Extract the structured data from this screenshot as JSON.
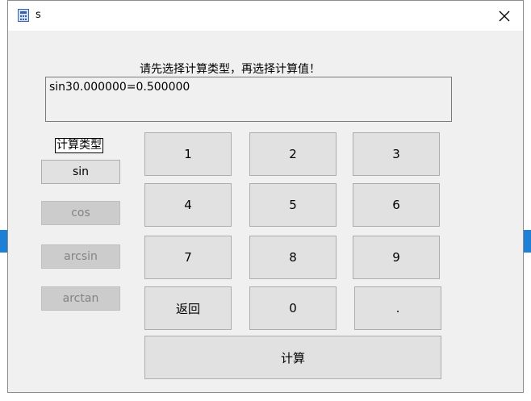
{
  "window": {
    "title": "s"
  },
  "prompt": "请先选择计算类型，再选择计算值！",
  "result": "sin30.000000=0.500000",
  "type_panel": {
    "label": "计算类型",
    "buttons": [
      {
        "label": "sin",
        "state": "enabled"
      },
      {
        "label": "cos",
        "state": "disabled"
      },
      {
        "label": "arcsin",
        "state": "disabled"
      },
      {
        "label": "arctan",
        "state": "disabled"
      }
    ]
  },
  "keypad": {
    "keys": [
      "1",
      "2",
      "3",
      "4",
      "5",
      "6",
      "7",
      "8",
      "9",
      "返回",
      "0",
      "."
    ],
    "calculate": "计算"
  },
  "colors": {
    "background_strip": "#1e7fd6",
    "button_face": "#e1e1e1",
    "disabled_text": "#838383"
  }
}
